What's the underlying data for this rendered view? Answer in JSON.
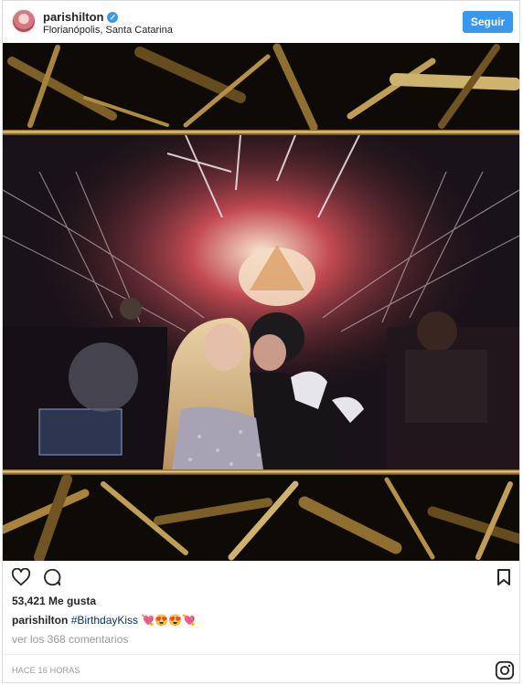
{
  "header": {
    "username": "parishilton",
    "verified_mark": "✓",
    "location": "Florianópolis, Santa Catarina",
    "follow_label": "Seguir"
  },
  "media": {
    "description_icon": "photo-dj-booth"
  },
  "actions": {
    "like_icon": "heart-outline-icon",
    "comment_icon": "comment-bubble-icon",
    "save_icon": "bookmark-icon"
  },
  "likes_text": "53,421 Me gusta",
  "caption": {
    "username": "parishilton",
    "hashtag": "#BirthdayKiss",
    "emojis": "💘😍😍💘"
  },
  "view_comments": "ver los 368 comentarios",
  "timestamp": "HACE 16 HORAS",
  "colors": {
    "accent": "#3897f0",
    "text": "#262626",
    "muted": "#999999",
    "hashtag": "#003569"
  }
}
